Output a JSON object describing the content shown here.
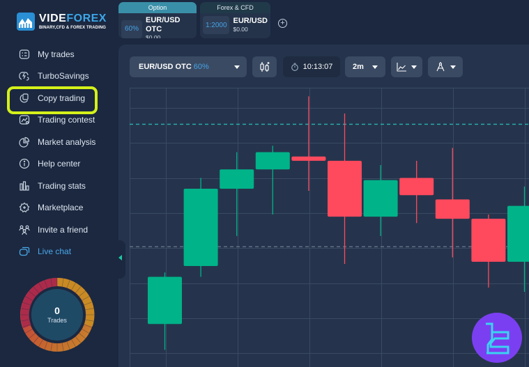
{
  "brand": {
    "name_part1": "VIDE",
    "name_part2": "FOREX",
    "tagline": "BINARY,CFD & FOREX TRADING"
  },
  "tabs": [
    {
      "header": "Option",
      "badge": "60%",
      "pair": "EUR/USD OTC",
      "amount": "$0.00",
      "active": true
    },
    {
      "header": "Forex & CFD",
      "badge": "1:2000",
      "pair": "EUR/USD",
      "amount": "$0.00",
      "active": false
    }
  ],
  "add_tab_icon": "plus-circle-icon",
  "sidebar": {
    "items": [
      {
        "label": "My trades",
        "icon": "trades-list-icon"
      },
      {
        "label": "TurboSavings",
        "icon": "turbo-savings-icon"
      },
      {
        "label": "Copy trading",
        "icon": "copy-trading-icon",
        "highlighted": true
      },
      {
        "label": "Trading contest",
        "icon": "contest-icon"
      },
      {
        "label": "Market analysis",
        "icon": "pie-chart-icon"
      },
      {
        "label": "Help center",
        "icon": "info-icon"
      },
      {
        "label": "Trading stats",
        "icon": "bar-chart-icon"
      },
      {
        "label": "Marketplace",
        "icon": "marketplace-icon"
      },
      {
        "label": "Invite a friend",
        "icon": "users-icon"
      },
      {
        "label": "Live chat",
        "icon": "chat-icon",
        "accent": true
      }
    ],
    "trades_widget": {
      "count": "0",
      "label": "Trades"
    }
  },
  "toolbar": {
    "pair": "EUR/USD OTC",
    "payout": "60%",
    "timer": "10:13:07",
    "timeframe": "2m"
  },
  "colors": {
    "bull": "#00b389",
    "bear": "#ff4a5e",
    "accent": "#46a3e6",
    "highlight": "#d4f01a",
    "background": "#1b2840",
    "panel": "#25344c"
  },
  "chart_data": {
    "type": "candlestick",
    "note": "Price axis not visible; values are relative price units (higher = higher price).",
    "candles": [
      {
        "open": 20,
        "close": 42,
        "high": 44,
        "low": 8,
        "dir": "up"
      },
      {
        "open": 47,
        "close": 83,
        "high": 88,
        "low": 42,
        "dir": "up"
      },
      {
        "open": 83,
        "close": 92,
        "high": 100,
        "low": 61,
        "dir": "up"
      },
      {
        "open": 92,
        "close": 100,
        "high": 103,
        "low": 71,
        "dir": "up"
      },
      {
        "open": 98,
        "close": 96,
        "high": 126,
        "low": 82,
        "dir": "down"
      },
      {
        "open": 96,
        "close": 70,
        "high": 118,
        "low": 48,
        "dir": "down"
      },
      {
        "open": 70,
        "close": 87,
        "high": 94,
        "low": 61,
        "dir": "up"
      },
      {
        "open": 88,
        "close": 80,
        "high": 96,
        "low": 67,
        "dir": "down"
      },
      {
        "open": 78,
        "close": 69,
        "high": 102,
        "low": 51,
        "dir": "down"
      },
      {
        "open": 69,
        "close": 49,
        "high": 71,
        "low": 37,
        "dir": "down"
      },
      {
        "open": 49,
        "close": 75,
        "high": 84,
        "low": 35,
        "dir": "up"
      }
    ],
    "reference_lines": [
      {
        "value": 113,
        "color": "teal",
        "style": "dashed"
      },
      {
        "value": 56,
        "color": "gray",
        "style": "dashed"
      }
    ],
    "ylim": [
      0,
      130
    ],
    "grid": true
  }
}
